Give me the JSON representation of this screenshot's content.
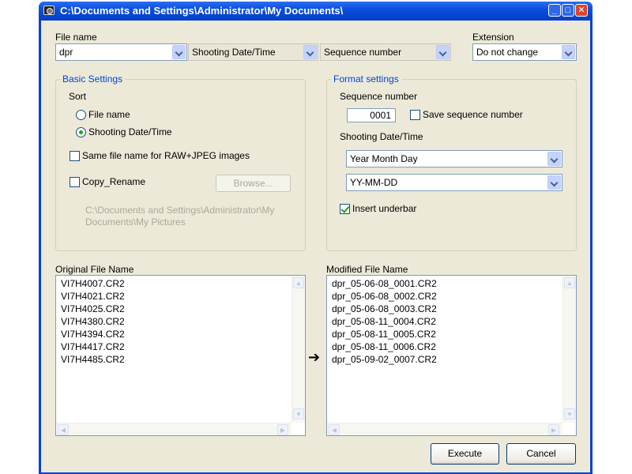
{
  "window": {
    "title": "C:\\Documents and Settings\\Administrator\\My Documents\\"
  },
  "file_name": {
    "label": "File name",
    "name_value": "dpr",
    "part2_value": "Shooting Date/Time",
    "part3_value": "Sequence number"
  },
  "extension": {
    "label": "Extension",
    "value": "Do not change"
  },
  "basic_settings": {
    "title": "Basic Settings",
    "sort_label": "Sort",
    "sort_options": [
      {
        "label": "File name",
        "selected": false
      },
      {
        "label": "Shooting Date/Time",
        "selected": true
      }
    ],
    "same_name_label": "Same file name for RAW+JPEG images",
    "same_name_checked": false,
    "copy_rename_label": "Copy_Rename",
    "copy_rename_checked": false,
    "browse_label": "Browse...",
    "path_line1": "C:\\Documents and Settings\\Administrator\\My",
    "path_line2": "Documents\\My Pictures"
  },
  "format_settings": {
    "title": "Format settings",
    "sequence_label": "Sequence number",
    "sequence_value": "0001",
    "save_sequence_label": "Save sequence number",
    "save_sequence_checked": false,
    "date_label": "Shooting Date/Time",
    "date_order_value": "Year Month Day",
    "date_format_value": "YY-MM-DD",
    "underbar_label": "Insert underbar",
    "underbar_checked": true
  },
  "original": {
    "label": "Original File Name",
    "files": [
      "VI7H4007.CR2",
      "VI7H4021.CR2",
      "VI7H4025.CR2",
      "VI7H4380.CR2",
      "VI7H4394.CR2",
      "VI7H4417.CR2",
      "VI7H4485.CR2"
    ]
  },
  "modified": {
    "label": "Modified File Name",
    "files": [
      "dpr_05-06-08_0001.CR2",
      "dpr_05-06-08_0002.CR2",
      "dpr_05-06-08_0003.CR2",
      "dpr_05-08-11_0004.CR2",
      "dpr_05-08-11_0005.CR2",
      "dpr_05-08-11_0006.CR2",
      "dpr_05-09-02_0007.CR2"
    ]
  },
  "arrow_glyph": "➔",
  "buttons": {
    "execute": "Execute",
    "cancel": "Cancel"
  }
}
